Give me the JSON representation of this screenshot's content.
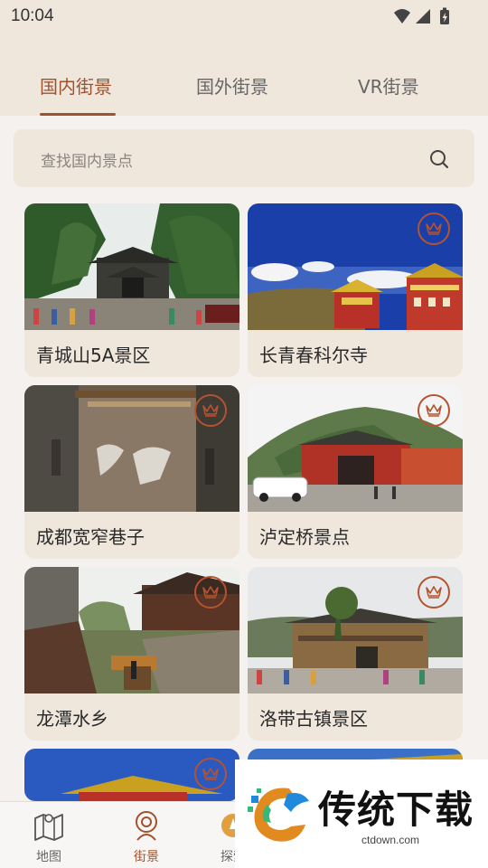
{
  "status_bar": {
    "time": "10:04"
  },
  "tabs": [
    {
      "label": "国内街景",
      "active": true
    },
    {
      "label": "国外街景",
      "active": false
    },
    {
      "label": "VR街景",
      "active": false
    }
  ],
  "search": {
    "placeholder": "查找国内景点"
  },
  "cards": [
    {
      "title": "青城山5A景区",
      "premium": false
    },
    {
      "title": "长青春科尔寺",
      "premium": true
    },
    {
      "title": "成都宽窄巷子",
      "premium": true
    },
    {
      "title": "泸定桥景点",
      "premium": true
    },
    {
      "title": "龙潭水乡",
      "premium": true
    },
    {
      "title": "洛带古镇景区",
      "premium": true
    }
  ],
  "bottom_nav": [
    {
      "label": "地图",
      "icon": "map-icon",
      "active": false
    },
    {
      "label": "街景",
      "icon": "street-view-icon",
      "active": true
    },
    {
      "label": "探索",
      "icon": "explore-icon",
      "active": false
    }
  ],
  "watermark": {
    "title": "传统下载",
    "url": "ctdown.com"
  },
  "colors": {
    "accent": "#a0522d",
    "header_bg": "#efe6dc",
    "page_bg": "#f4f1ee",
    "crown": "#b5532f"
  }
}
